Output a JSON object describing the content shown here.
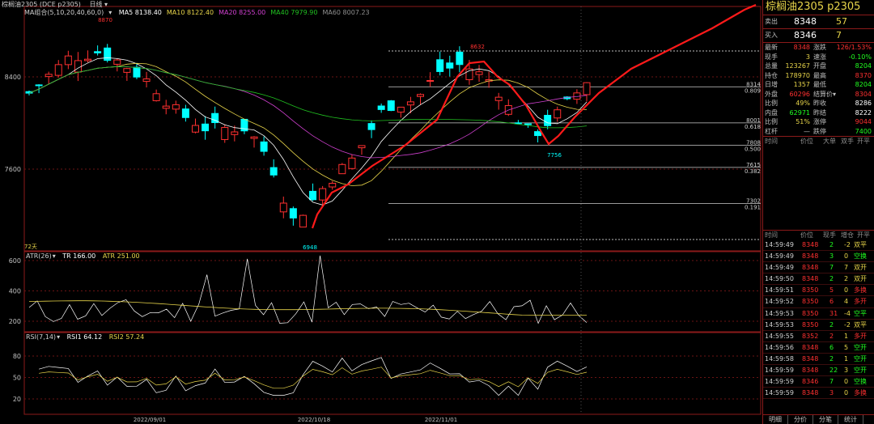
{
  "header": {
    "symbol": "棕榈油2305 (DCE p2305)",
    "period": "日线"
  },
  "ma_bar": {
    "label": "MA组合(5,10,20,40,60,0)",
    "items": [
      {
        "text": "MA5 8138.40",
        "color": "#ffffff"
      },
      {
        "text": "MA10 8122.40",
        "color": "#e8d54a"
      },
      {
        "text": "MA20 8255.00",
        "color": "#d040d0"
      },
      {
        "text": "MA40 7979.90",
        "color": "#20c020"
      },
      {
        "text": "MA60 8007.23",
        "color": "#909090"
      }
    ]
  },
  "main": {
    "y_ticks": [
      {
        "value": 8400,
        "label": "8400"
      },
      {
        "value": 7600,
        "label": "7600"
      }
    ],
    "annotations": {
      "high1": "8870",
      "high2": "8632",
      "low1": "6948",
      "low2": "7756"
    },
    "fib": [
      {
        "price": 8314,
        "label": "8314",
        "ratio": "0.809"
      },
      {
        "price": 8001,
        "label": "8001",
        "ratio": "0.618"
      },
      {
        "price": 7808,
        "label": "7808",
        "ratio": "0.500"
      },
      {
        "price": 7615,
        "label": "7615",
        "ratio": "0.382"
      },
      {
        "price": 7302,
        "label": "7302",
        "ratio": "0.191"
      }
    ],
    "days_label": "72天",
    "x_labels": [
      "2022/09/01",
      "2022/10/18",
      "2022/11/01"
    ]
  },
  "atr": {
    "label": "ATR(26)",
    "tr": "TR 166.00",
    "atr": "ATR 251.00",
    "y_ticks": [
      "600",
      "400",
      "200"
    ]
  },
  "rsi": {
    "label": "RSI(7,14)",
    "rsi1": "RSI1 64.12",
    "rsi2": "RSI2 57.24",
    "y_ticks": [
      "80",
      "50",
      "20"
    ]
  },
  "colors": {
    "up": "#ff3030",
    "down": "#00ffff",
    "frame": "#8b1a1a",
    "label": "#e8d54a",
    "trend": "#ff1a1a"
  },
  "side": {
    "title": "棕榈油2305",
    "code": "p2305",
    "ask": {
      "label": "卖出",
      "price": "8348",
      "qty": "57"
    },
    "bid": {
      "label": "买入",
      "price": "8346",
      "qty": "7"
    },
    "quote": [
      {
        "l1": "最新",
        "v1": "8348",
        "c1": "#ff3030",
        "l2": "涨跌",
        "v2": "126/1.53%",
        "c2": "#ff3030"
      },
      {
        "l1": "现手",
        "v1": "3",
        "c1": "#e8d54a",
        "l2": "速涨",
        "v2": "-0.10%",
        "c2": "#20ff20"
      },
      {
        "l1": "总量",
        "v1": "123267",
        "c1": "#e8d54a",
        "l2": "开盘",
        "v2": "8204",
        "c2": "#20ff20"
      },
      {
        "l1": "持仓",
        "v1": "178970",
        "c1": "#e8d54a",
        "l2": "最高",
        "v2": "8370",
        "c2": "#ff3030"
      },
      {
        "l1": "日增",
        "v1": "1357",
        "c1": "#e8d54a",
        "l2": "最低",
        "v2": "8204",
        "c2": "#20ff20"
      },
      {
        "l1": "外盘",
        "v1": "60296",
        "c1": "#ff3030",
        "l2": "结算价▾",
        "v2": "8304",
        "c2": "#ff3030"
      },
      {
        "l1": "比例",
        "v1": "49%",
        "c1": "#e8d54a",
        "l2": "昨收",
        "v2": "8286",
        "c2": "#ffffff"
      },
      {
        "l1": "内盘",
        "v1": "62971",
        "c1": "#20ff20",
        "l2": "昨结",
        "v2": "8222",
        "c2": "#ffffff"
      },
      {
        "l1": "比例",
        "v1": "51%",
        "c1": "#e8d54a",
        "l2": "涨停",
        "v2": "9044",
        "c2": "#ff3030"
      },
      {
        "l1": "杠杆",
        "v1": "—",
        "c1": "#c0c0c0",
        "l2": "跌停",
        "v2": "7400",
        "c2": "#20ff20"
      }
    ],
    "cols1": [
      "时间",
      "价位",
      "大单",
      "双手",
      "开平"
    ],
    "cols2": [
      "时间",
      "价位",
      "现手",
      "增仓",
      "开平"
    ],
    "trades": [
      {
        "t": "14:59:49",
        "p": "8348",
        "pc": "#ff3030",
        "q": "2",
        "qc": "#20ff20",
        "d": "-2",
        "oc": "双平"
      },
      {
        "t": "14:59:49",
        "p": "8348",
        "pc": "#ff3030",
        "q": "3",
        "qc": "#20ff20",
        "d": "0",
        "oc": "空换"
      },
      {
        "t": "14:59:49",
        "p": "8348",
        "pc": "#ff3030",
        "q": "7",
        "qc": "#20ff20",
        "d": "7",
        "oc": "双开"
      },
      {
        "t": "14:59:50",
        "p": "8348",
        "pc": "#ff3030",
        "q": "2",
        "qc": "#20ff20",
        "d": "2",
        "oc": "双开"
      },
      {
        "t": "14:59:51",
        "p": "8350",
        "pc": "#ff3030",
        "q": "5",
        "qc": "#ff3030",
        "d": "0",
        "oc": "多换"
      },
      {
        "t": "14:59:52",
        "p": "8350",
        "pc": "#ff3030",
        "q": "6",
        "qc": "#ff3030",
        "d": "4",
        "oc": "多开"
      },
      {
        "t": "14:59:53",
        "p": "8350",
        "pc": "#ff3030",
        "q": "31",
        "qc": "#ff3030",
        "d": "-4",
        "oc": "空平"
      },
      {
        "t": "14:59:53",
        "p": "8350",
        "pc": "#ff3030",
        "q": "2",
        "qc": "#20ff20",
        "d": "-2",
        "oc": "双平"
      },
      {
        "t": "14:59:55",
        "p": "8352",
        "pc": "#ff3030",
        "q": "2",
        "qc": "#ff3030",
        "d": "1",
        "oc": "多开"
      },
      {
        "t": "14:59:56",
        "p": "8348",
        "pc": "#ff3030",
        "q": "6",
        "qc": "#20ff20",
        "d": "5",
        "oc": "空开"
      },
      {
        "t": "14:59:58",
        "p": "8348",
        "pc": "#ff3030",
        "q": "2",
        "qc": "#20ff20",
        "d": "1",
        "oc": "空开"
      },
      {
        "t": "14:59:59",
        "p": "8348",
        "pc": "#ff3030",
        "q": "22",
        "qc": "#20ff20",
        "d": "3",
        "oc": "空开"
      },
      {
        "t": "14:59:59",
        "p": "8346",
        "pc": "#ff3030",
        "q": "7",
        "qc": "#20ff20",
        "d": "0",
        "oc": "空换"
      },
      {
        "t": "14:59:59",
        "p": "8348",
        "pc": "#ff3030",
        "q": "3",
        "qc": "#ff3030",
        "d": "0",
        "oc": "多换"
      }
    ],
    "tabs": [
      "明细",
      "分价",
      "分笔",
      "统计"
    ]
  }
}
